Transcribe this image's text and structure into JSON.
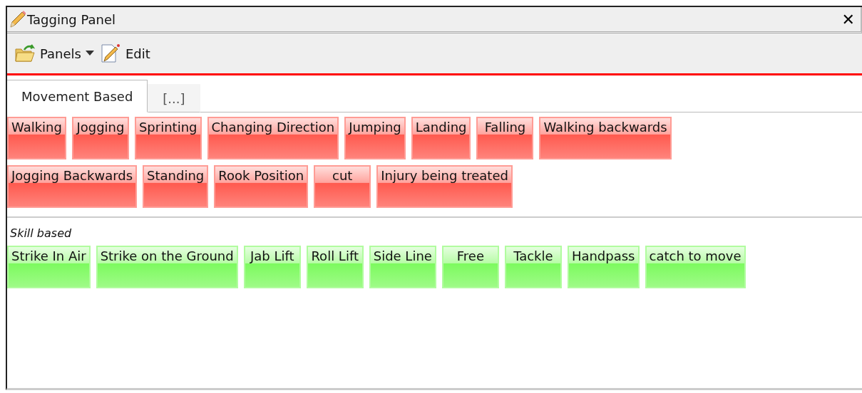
{
  "window": {
    "title": "Tagging Panel",
    "close": "✕"
  },
  "toolbar": [
    {
      "label": "Panels",
      "kind": "dropdown"
    },
    {
      "label": "Edit",
      "kind": "edit"
    }
  ],
  "tabs": [
    {
      "label": "Movement Based",
      "selected": true
    },
    {
      "label": "[...]",
      "selected": false
    }
  ],
  "sections": [
    {
      "color": "#ff5a4f",
      "tags": [
        "Walking",
        "Jogging",
        "Sprinting",
        "Changing Direction",
        "Jumping",
        "Landing",
        "Falling",
        "Walking backwards",
        "Jogging Backwards",
        "Standing",
        "Rook Position",
        "cut",
        "Injury being treated"
      ]
    },
    {
      "title": "Skill based",
      "color": "#7dfa5f",
      "tags": [
        "Strike In Air",
        "Strike on the Ground",
        "Jab Lift",
        "Roll Lift",
        "Side Line",
        "Free",
        "Tackle",
        "Handpass",
        "catch to move"
      ]
    }
  ]
}
